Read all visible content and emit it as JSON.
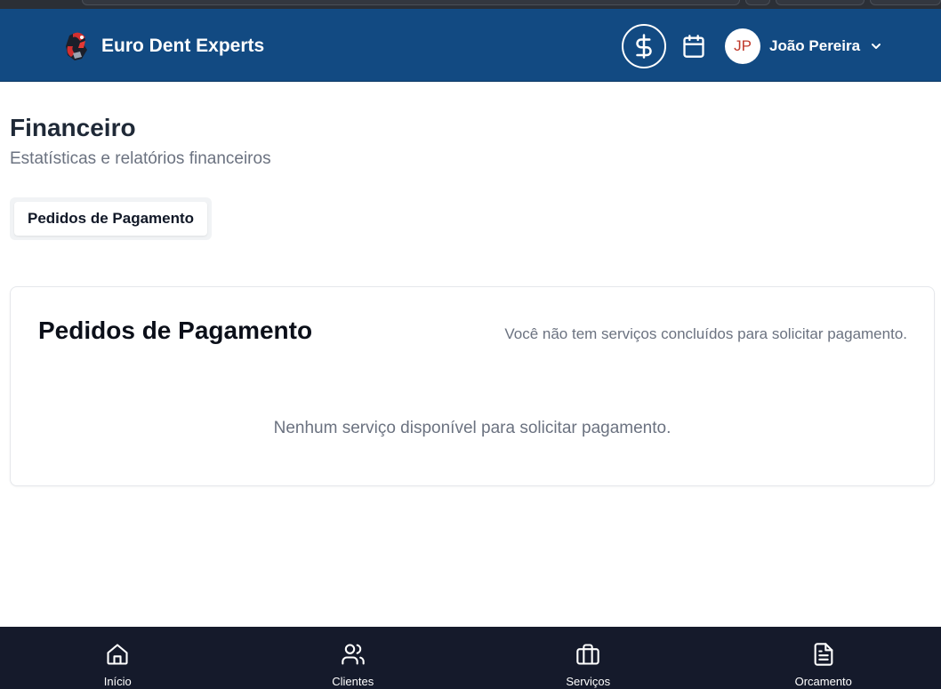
{
  "header": {
    "brand_name": "Euro Dent Experts",
    "money_icon": "dollar-icon",
    "calendar_icon": "calendar-icon",
    "user": {
      "initials": "JP",
      "name": "João Pereira"
    }
  },
  "page": {
    "title": "Financeiro",
    "subtitle": "Estatísticas e relatórios financeiros"
  },
  "tabs": [
    {
      "label": "Pedidos de Pagamento",
      "active": true
    }
  ],
  "card": {
    "title": "Pedidos de Pagamento",
    "description": "Você não tem serviços concluídos para solicitar pagamento.",
    "empty_message": "Nenhum serviço disponível para solicitar pagamento."
  },
  "bottom_nav": [
    {
      "label": "Início",
      "icon": "home-icon"
    },
    {
      "label": "Clientes",
      "icon": "users-icon"
    },
    {
      "label": "Serviços",
      "icon": "briefcase-icon"
    },
    {
      "label": "Orcamento",
      "icon": "document-icon"
    }
  ],
  "colors": {
    "header_bg": "#124a82",
    "bottom_nav_bg": "#151a2b",
    "avatar_text": "#c0392b"
  }
}
